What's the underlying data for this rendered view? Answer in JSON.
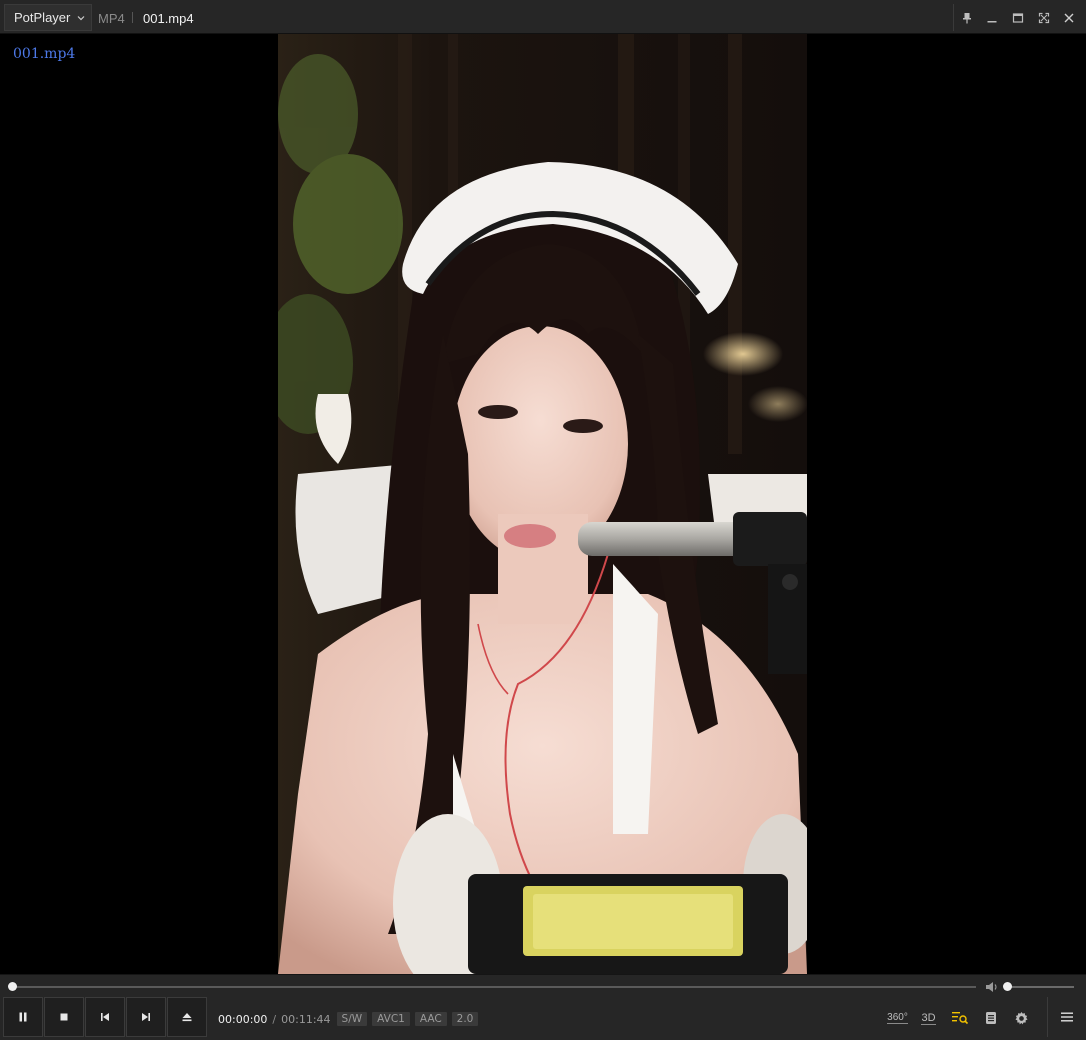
{
  "titlebar": {
    "app_name": "PotPlayer",
    "format": "MP4",
    "filename": "001.mp4"
  },
  "osd": {
    "filename": "001.mp4"
  },
  "playback": {
    "current_time": "00:00:00",
    "separator": "/",
    "duration": "00:11:44",
    "position_fraction": 0.0,
    "volume_fraction": 0.0
  },
  "badges": {
    "decoder": "S/W",
    "video_codec": "AVC1",
    "audio_codec": "AAC",
    "channels": "2.0"
  },
  "right_controls": {
    "vr_label": "360°",
    "stereo_label": "3D"
  },
  "icons": [
    "chevron-down-icon",
    "pin-icon",
    "minimize-icon",
    "maximize-icon",
    "fullscreen-icon",
    "close-icon",
    "volume-icon",
    "pause-icon",
    "stop-icon",
    "previous-icon",
    "next-icon",
    "eject-icon",
    "360-icon",
    "3d-icon",
    "playlist-search-icon",
    "chapter-icon",
    "gear-icon",
    "hamburger-menu-icon"
  ],
  "colors": {
    "osd_text": "#4d79e8",
    "accent_playlist_icon": "#f2c200",
    "bar_bg": "#262626"
  }
}
